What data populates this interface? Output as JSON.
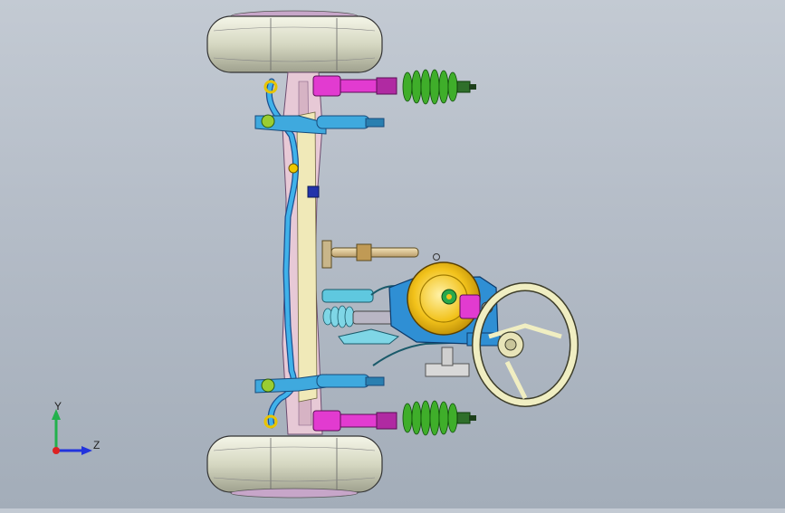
{
  "viewport": {
    "background_top": "#c3cad3",
    "background_bottom": "#a3adb9"
  },
  "triad": {
    "y_label": "Y",
    "z_label": "Z",
    "y_color": "#22b14c",
    "z_color": "#2233dd",
    "x_color": "#dd2222"
  },
  "model": {
    "tire_color": "#d7d9c4",
    "spring_color": "#3fae2a",
    "strut_color": "#e23bd0",
    "frame_color": "#2f9fd8",
    "wheel_color": "#f0eec2",
    "booster_color": "#f2c21b",
    "body_pink": "#e7c9d6"
  }
}
